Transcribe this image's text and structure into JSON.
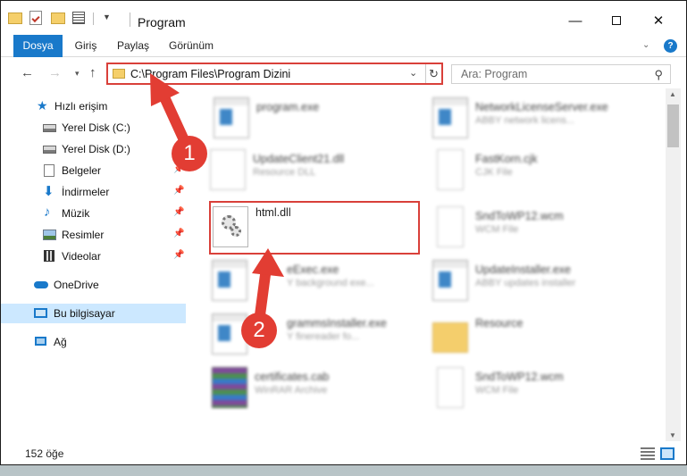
{
  "window": {
    "title": "Program"
  },
  "ribbon": {
    "tabs": [
      "Dosya",
      "Giriş",
      "Paylaş",
      "Görünüm"
    ]
  },
  "address": {
    "path": "C:\\Program Files\\Program Dizini"
  },
  "search": {
    "placeholder": "Ara: Program"
  },
  "sidebar": {
    "items": [
      {
        "label": "Hızlı erişim",
        "icon": "star-icon"
      },
      {
        "label": "Yerel Disk (C:)",
        "icon": "disk-icon"
      },
      {
        "label": "Yerel Disk (D:)",
        "icon": "disk-icon"
      },
      {
        "label": "Belgeler",
        "icon": "documents-icon"
      },
      {
        "label": "İndirmeler",
        "icon": "download-icon"
      },
      {
        "label": "Müzik",
        "icon": "music-icon"
      },
      {
        "label": "Resimler",
        "icon": "pictures-icon"
      },
      {
        "label": "Videolar",
        "icon": "videos-icon"
      },
      {
        "label": "OneDrive",
        "icon": "cloud-icon"
      },
      {
        "label": "Bu bilgisayar",
        "icon": "computer-icon"
      },
      {
        "label": "Ağ",
        "icon": "network-icon"
      }
    ]
  },
  "files": [
    {
      "name": "program.exe",
      "desc": ""
    },
    {
      "name": "NetworkLicenseServer.exe",
      "desc": "ABBY network licens..."
    },
    {
      "name": "UpdateClient21.dll",
      "desc": "Resource DLL"
    },
    {
      "name": "FastKorn.cjk",
      "desc": "CJK File"
    },
    {
      "name": "html.dll",
      "desc": ""
    },
    {
      "name": "SndToWP12.wcm",
      "desc": "WCM File"
    },
    {
      "name": "eExec.exe",
      "desc": "Y background exe..."
    },
    {
      "name": "UpdateInstaller.exe",
      "desc": "ABBY updates installer"
    },
    {
      "name": "grammsInstaller.exe",
      "desc": "Y finereader fo..."
    },
    {
      "name": "Resource",
      "desc": ""
    },
    {
      "name": "certificates.cab",
      "desc": "WinRAR Archive"
    },
    {
      "name": "SndToWP12.wcm",
      "desc": "WCM File"
    }
  ],
  "annotations": {
    "step1": "1",
    "step2": "2"
  },
  "status": {
    "count": "152 öğe"
  },
  "colors": {
    "accent": "#1979ca",
    "annotation": "#e23d33",
    "selected": "#cce8ff"
  }
}
